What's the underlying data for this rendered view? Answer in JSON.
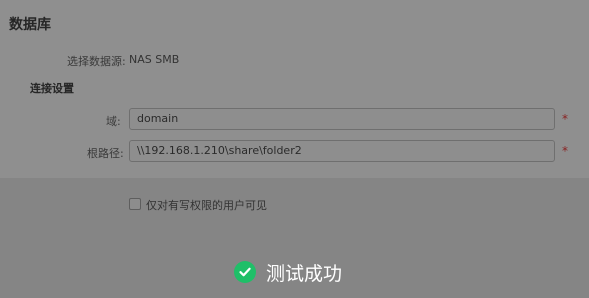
{
  "section_title": "数据库",
  "datasource": {
    "label": "选择数据源:",
    "value": "NAS SMB"
  },
  "connection": {
    "heading": "连接设置",
    "domain_label": "域:",
    "domain_value": "domain",
    "path_label": "根路径:",
    "path_value": "\\\\192.168.1.210\\share\\folder2",
    "required_mark": "*"
  },
  "options": {
    "write_only_label": "仅对有写权限的用户可见",
    "write_only_checked": false
  },
  "toast": {
    "message": "测试成功",
    "icon": "check-circle-icon",
    "color": "#1fbf68"
  }
}
